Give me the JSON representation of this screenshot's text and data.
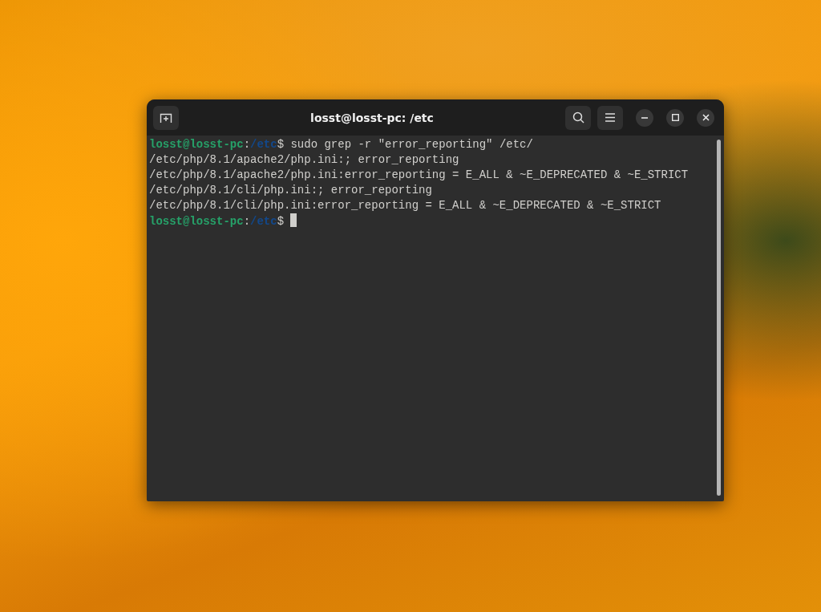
{
  "window": {
    "title": "losst@losst-pc: /etc"
  },
  "terminal": {
    "lines": [
      {
        "segments": [
          {
            "kind": "user",
            "text": "losst@losst-pc"
          },
          {
            "kind": "plain",
            "text": ":"
          },
          {
            "kind": "path",
            "text": "/etc"
          },
          {
            "kind": "plain",
            "text": "$ sudo grep -r \"error_reporting\" /etc/"
          }
        ]
      },
      {
        "segments": [
          {
            "kind": "plain",
            "text": "/etc/php/8.1/apache2/php.ini:; error_reporting"
          }
        ]
      },
      {
        "segments": [
          {
            "kind": "plain",
            "text": "/etc/php/8.1/apache2/php.ini:error_reporting = E_ALL & ~E_DEPRECATED & ~E_STRICT"
          }
        ]
      },
      {
        "segments": [
          {
            "kind": "plain",
            "text": "/etc/php/8.1/cli/php.ini:; error_reporting"
          }
        ]
      },
      {
        "segments": [
          {
            "kind": "plain",
            "text": "/etc/php/8.1/cli/php.ini:error_reporting = E_ALL & ~E_DEPRECATED & ~E_STRICT"
          }
        ]
      },
      {
        "segments": [
          {
            "kind": "user",
            "text": "losst@losst-pc"
          },
          {
            "kind": "plain",
            "text": ":"
          },
          {
            "kind": "path",
            "text": "/etc"
          },
          {
            "kind": "plain",
            "text": "$ "
          },
          {
            "kind": "cursor"
          }
        ]
      }
    ]
  }
}
